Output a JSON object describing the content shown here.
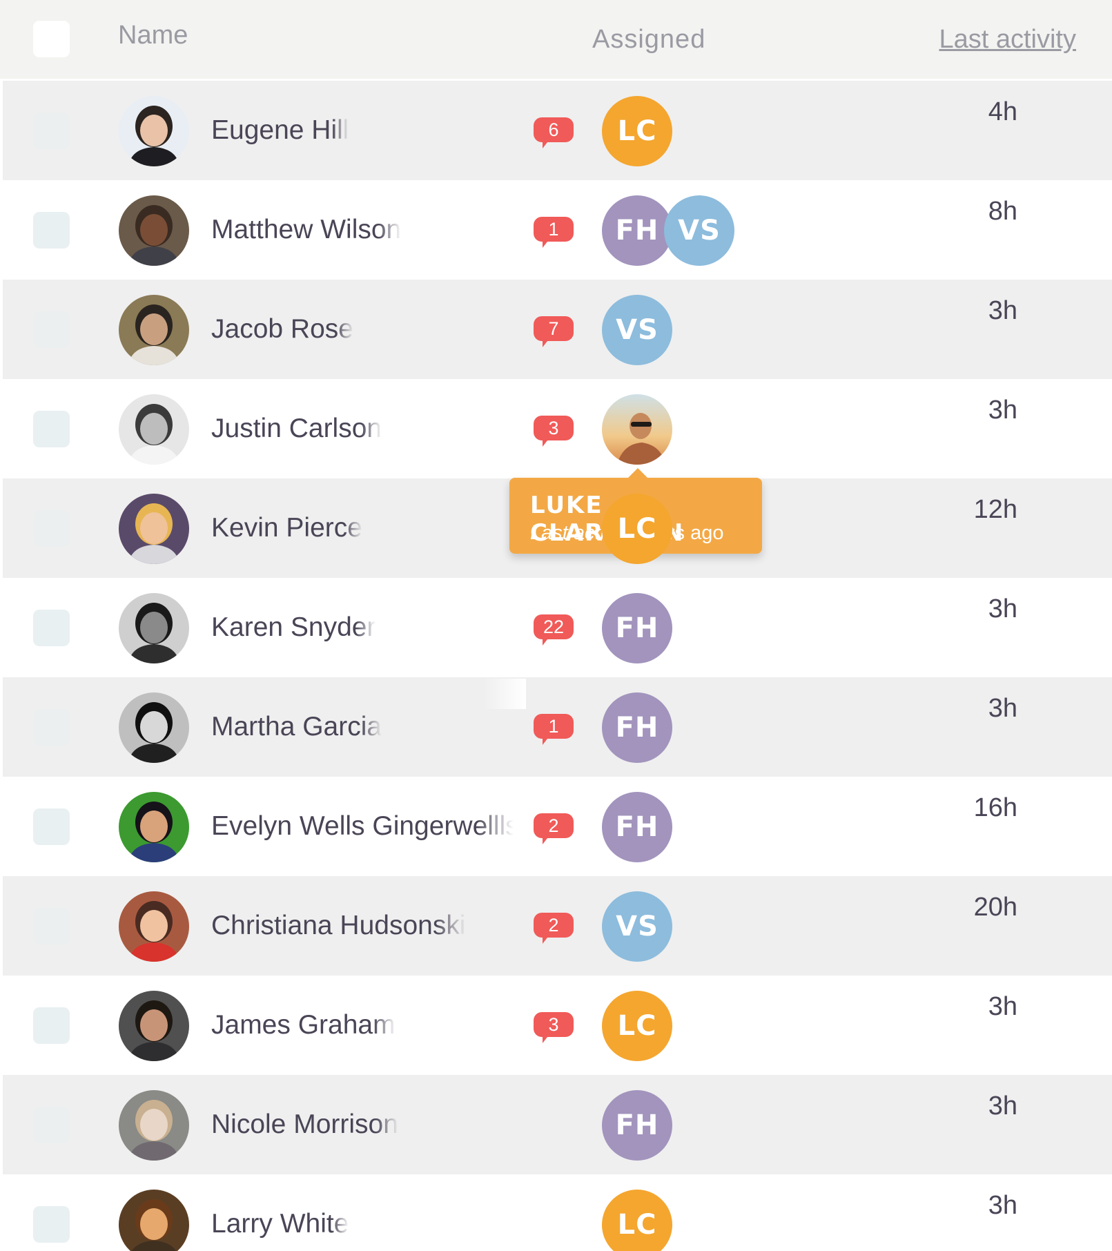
{
  "header": {
    "name_label": "Name",
    "assigned_label": "Assigned",
    "last_activity_label": "Last activity"
  },
  "colors": {
    "LC": "#f4a62f",
    "FH": "#a294bd",
    "VS": "#8dbcdd",
    "badge": "#f05a58",
    "tooltip": "#f3a845"
  },
  "rows": [
    {
      "name": "Eugene Hill",
      "badge": "6",
      "assignees": [
        "LC"
      ],
      "activity": "4h"
    },
    {
      "name": "Matthew Wilson",
      "badge": "1",
      "assignees": [
        "FH",
        "VS"
      ],
      "activity": "8h"
    },
    {
      "name": "Jacob Rose",
      "badge": "7",
      "assignees": [
        "VS"
      ],
      "activity": "3h"
    },
    {
      "name": "Justin Carlson",
      "badge": "3",
      "assignees": [
        "photo"
      ],
      "activity": "3h"
    },
    {
      "name": "Kevin Pierce",
      "badge": "",
      "assignees": [
        "LC"
      ],
      "activity": "12h"
    },
    {
      "name": "Karen Snyder",
      "badge": "22",
      "assignees": [
        "FH"
      ],
      "activity": "3h"
    },
    {
      "name": "Martha Garcia",
      "badge": "1",
      "assignees": [
        "FH"
      ],
      "activity": "3h"
    },
    {
      "name": "Evelyn Wells Gingerwellls",
      "badge": "2",
      "assignees": [
        "FH"
      ],
      "activity": "16h"
    },
    {
      "name": "Christiana Hudsonski",
      "badge": "2",
      "assignees": [
        "VS"
      ],
      "activity": "20h"
    },
    {
      "name": "James Graham",
      "badge": "3",
      "assignees": [
        "LC"
      ],
      "activity": "3h"
    },
    {
      "name": "Nicole Morrison",
      "badge": "",
      "assignees": [
        "FH"
      ],
      "activity": "3h"
    },
    {
      "name": "Larry White",
      "badge": "",
      "assignees": [
        "LC"
      ],
      "activity": "3h"
    }
  ],
  "tooltip": {
    "title": "LUKE CLARKSON",
    "label": "Last activity:",
    "value": "8hrs ago"
  }
}
